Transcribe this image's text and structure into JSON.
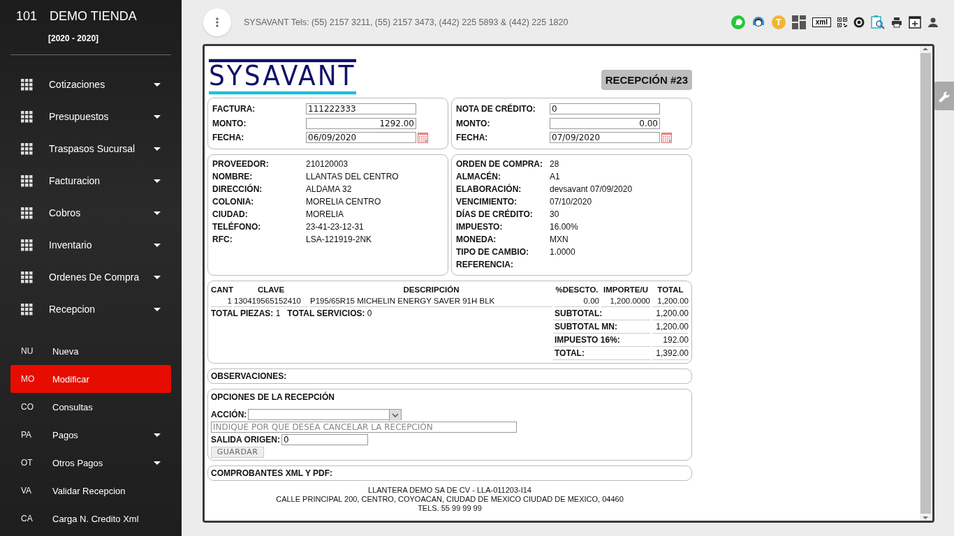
{
  "sidebar": {
    "store_code": "101",
    "store_name": "DEMO TIENDA",
    "period": "[2020 - 2020]",
    "menu": [
      {
        "label": "Cotizaciones"
      },
      {
        "label": "Presupuestos"
      },
      {
        "label": "Traspasos Sucursal"
      },
      {
        "label": "Facturacion"
      },
      {
        "label": "Cobros"
      },
      {
        "label": "Inventario"
      },
      {
        "label": "Ordenes De Compra"
      },
      {
        "label": "Recepcion"
      }
    ],
    "submenu": [
      {
        "code": "NU",
        "label": "Nueva",
        "selected": false,
        "kind": "link"
      },
      {
        "code": "MO",
        "label": "Modificar",
        "selected": true,
        "kind": "link"
      },
      {
        "code": "CO",
        "label": "Consultas",
        "selected": false,
        "kind": "link"
      },
      {
        "code": "PA",
        "label": "Pagos",
        "selected": false,
        "kind": "group"
      },
      {
        "code": "OT",
        "label": "Otros Pagos",
        "selected": false,
        "kind": "group"
      },
      {
        "code": "VA",
        "label": "Validar Recepcion",
        "selected": false,
        "kind": "link"
      },
      {
        "code": "CA",
        "label": "Carga N. Credito Xml",
        "selected": false,
        "kind": "link"
      }
    ]
  },
  "topbar": {
    "contact": "SYSAVANT Tels: (55) 2157 3211, (55) 2157 3473, (442) 225 5893 & (442) 225 1820",
    "user_initial": "T",
    "xml_label": "xml"
  },
  "document": {
    "logo": "SYSAVANT",
    "title": "RECEPCIÓN #23",
    "invoice": [
      {
        "label": "FACTURA:",
        "value": "111222333",
        "kind": "text"
      },
      {
        "label": "MONTO:",
        "value": "1292.00",
        "kind": "amount"
      },
      {
        "label": "FECHA:",
        "value": "06/09/2020",
        "kind": "date"
      }
    ],
    "credit_note": [
      {
        "label": "NOTA DE CRÉDITO:",
        "value": "0",
        "kind": "text"
      },
      {
        "label": "MONTO:",
        "value": "0.00",
        "kind": "amount"
      },
      {
        "label": "FECHA:",
        "value": "07/09/2020",
        "kind": "date"
      }
    ],
    "supplier": [
      {
        "label": "PROVEEDOR:",
        "value": "210120003"
      },
      {
        "label": "NOMBRE:",
        "value": "LLANTAS DEL CENTRO"
      },
      {
        "label": "DIRECCIÓN:",
        "value": "ALDAMA 32"
      },
      {
        "label": "COLONIA:",
        "value": "MORELIA CENTRO"
      },
      {
        "label": "CIUDAD:",
        "value": "MORELIA"
      },
      {
        "label": "TELÉFONO:",
        "value": "23-41-23-12-31"
      },
      {
        "label": "RFC:",
        "value": "LSA-121919-2NK"
      }
    ],
    "order": [
      {
        "label": "ORDEN DE COMPRA:",
        "value": "28"
      },
      {
        "label": "ALMACÉN:",
        "value": "A1"
      },
      {
        "label": "ELABORACIÓN:",
        "value": "devsavant 07/09/2020"
      },
      {
        "label": "VENCIMIENTO:",
        "value": "07/10/2020"
      },
      {
        "label": "DÍAS DE CRÉDITO:",
        "value": "30"
      },
      {
        "label": "IMPUESTO:",
        "value": "16.00%"
      },
      {
        "label": "MONEDA:",
        "value": "MXN"
      },
      {
        "label": "TIPO DE CAMBIO:",
        "value": "1.0000"
      },
      {
        "label": "REFERENCIA:"
      }
    ],
    "items": {
      "columns": [
        "CANT",
        "CLAVE",
        "DESCRIPCIÓN",
        "%DESCTO.",
        "IMPORTE/U",
        "TOTAL"
      ],
      "rows": [
        [
          "1",
          "130419565152410",
          "P195/65R15 MICHELIN ENERGY SAVER 91H BLK",
          "0.00",
          "1,200.0000",
          "1,200.00"
        ]
      ],
      "summary": [
        "**TOTAL PIEZAS:** 1",
        "**TOTAL SERVICIOS:** 0"
      ],
      "totals": [
        {
          "label": "SUBTOTAL:",
          "value": "1,200.00"
        },
        {
          "label": "SUBTOTAL MN:",
          "value": "1,200.00"
        },
        {
          "label": "IMPUESTO 16%:",
          "value": "192.00"
        },
        {
          "label": "TOTAL:",
          "value": "1,392.00"
        }
      ]
    },
    "observations_title": "OBSERVACIONES:",
    "options": {
      "title": "OPCIONES DE LA RECEPCIÓN",
      "action_label": "ACCIÓN:",
      "reason_placeholder": "INDIQUE POR QUE DESEA CANCELAR LA RECEPCIÓN",
      "origin_label": "SALIDA ORIGEN:",
      "origin_value": "0",
      "save_button": "GUARDAR"
    },
    "attachments_title": "COMPROBANTES XML Y PDF:",
    "footer": [
      "LLANTERA DEMO SA DE CV - LLA-011203-I14",
      "CALLE PRINCIPAL 200, CENTRO, COYOACAN, CIUDAD DE MEXICO CIUDAD DE MEXICO, 04460",
      "TELS. 55 99 99 99"
    ]
  }
}
